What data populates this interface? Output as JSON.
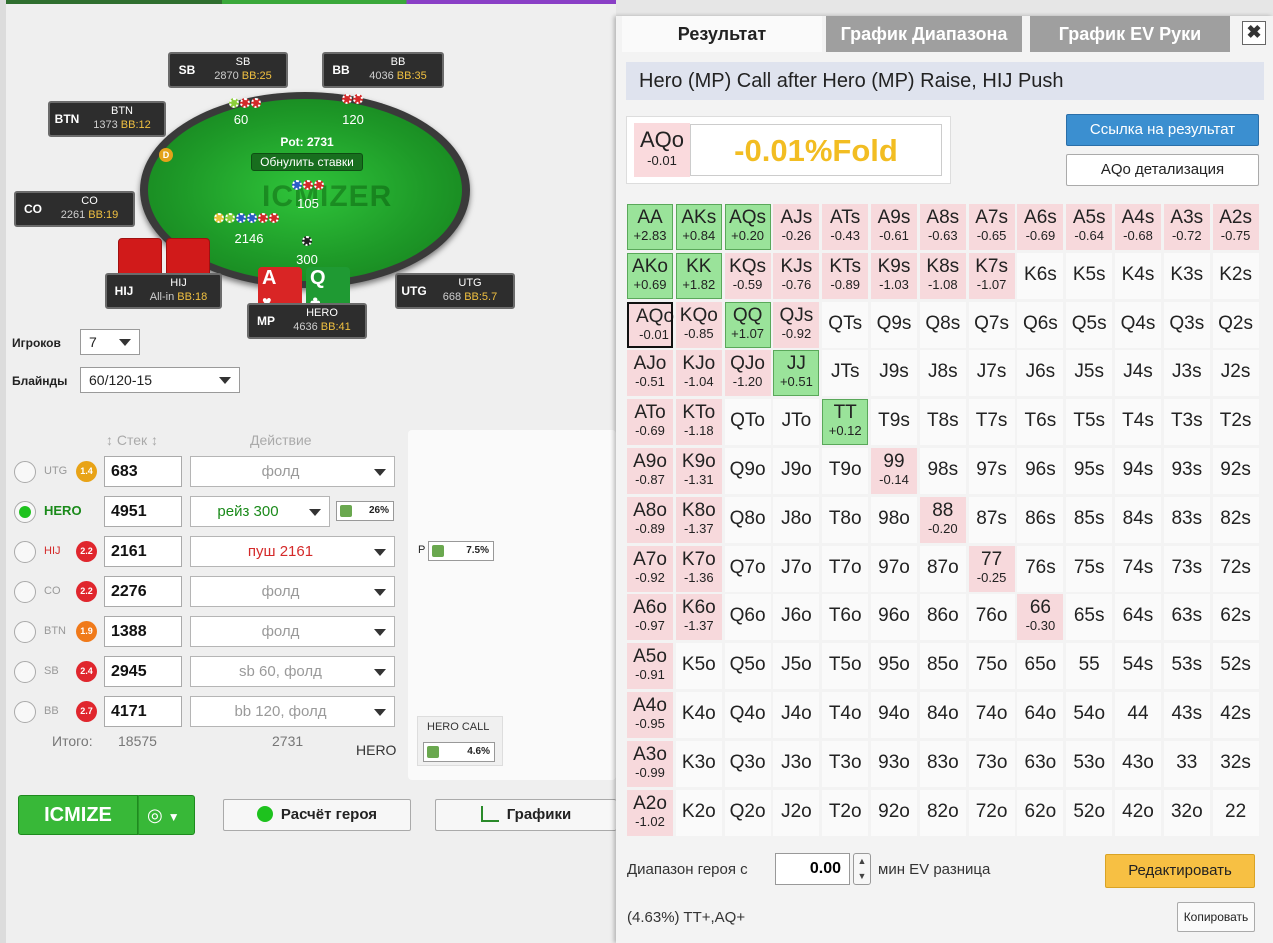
{
  "table": {
    "pot_label": "Pot: 2731",
    "reset_label": "Обнулить ставки",
    "watermark": "ICMIZER",
    "bets": {
      "sb": "60",
      "bb": "120",
      "hij": "2146",
      "hero": "300",
      "center": "105"
    },
    "dealer": "D",
    "seats": {
      "sb": {
        "pos": "SB",
        "name": "SB",
        "stack": "2870",
        "bb": "BB:25"
      },
      "bb": {
        "pos": "BB",
        "name": "BB",
        "stack": "4036",
        "bb": "BB:35"
      },
      "btn": {
        "pos": "BTN",
        "name": "BTN",
        "stack": "1373",
        "bb": "BB:12"
      },
      "co": {
        "pos": "CO",
        "name": "CO",
        "stack": "2261",
        "bb": "BB:19"
      },
      "hij": {
        "pos": "HIJ",
        "name": "HIJ",
        "stack": "All-in",
        "bb": "BB:18"
      },
      "utg": {
        "pos": "UTG",
        "name": "UTG",
        "stack": "668",
        "bb": "BB:5.7"
      },
      "hero": {
        "pos": "MP",
        "name": "HERO",
        "stack": "4636",
        "bb": "BB:41"
      }
    },
    "hero_cards": [
      {
        "rank": "A",
        "suit": "♥"
      },
      {
        "rank": "Q",
        "suit": "♣"
      }
    ]
  },
  "settings": {
    "players_label": "Игроков",
    "players_value": "7",
    "blinds_label": "Блайнды",
    "blinds_value": "60/120-15"
  },
  "columns": {
    "stack": "Стек",
    "action": "Действие"
  },
  "players": [
    {
      "name": "UTG",
      "badge": "1.4",
      "badge_color": "#e8a317",
      "stack": "683",
      "action": "фолд",
      "selected": false
    },
    {
      "name": "HERO",
      "badge": "",
      "badge_color": "",
      "stack": "4951",
      "action": "рейз 300",
      "selected": true,
      "pct": "26%"
    },
    {
      "name": "HIJ",
      "badge": "2.2",
      "badge_color": "#e0262d",
      "stack": "2161",
      "action": "пуш 2161",
      "selected": false
    },
    {
      "name": "CO",
      "badge": "2.2",
      "badge_color": "#e0262d",
      "stack": "2276",
      "action": "фолд",
      "selected": false
    },
    {
      "name": "BTN",
      "badge": "1.9",
      "badge_color": "#f07a1a",
      "stack": "1388",
      "action": "фолд",
      "selected": false
    },
    {
      "name": "SB",
      "badge": "2.4",
      "badge_color": "#e0262d",
      "stack": "2945",
      "action": "sb 60, фолд",
      "selected": false
    },
    {
      "name": "BB",
      "badge": "2.7",
      "badge_color": "#e0262d",
      "stack": "4171",
      "action": "bb 120, фолд",
      "selected": false
    }
  ],
  "totals": {
    "label": "Итого:",
    "stack": "18575",
    "action": "2731"
  },
  "range_pane": {
    "p_label": "P",
    "p_pct": "7.5%",
    "call_label": "HERO CALL",
    "call_pct": "4.6%",
    "hero_label": "HERO"
  },
  "buttons": {
    "icmize": "ICMIZE",
    "icmize_dd": "◎",
    "hero_calc": "Расчёт героя",
    "charts": "Графики"
  },
  "tabs": [
    "Результат",
    "График Диапазона",
    "График EV Руки"
  ],
  "close": "✖",
  "scenario": "Hero (MP) Call after Hero (MP) Raise, HIJ Push",
  "result": {
    "hand": "AQo",
    "ev": "-0.01",
    "text": "-0.01%Fold"
  },
  "link_button": "Ссылка на результат",
  "detail_button": "AQo детализация",
  "range_label": "Диапазон героя с",
  "min_ev_value": "0.00",
  "min_ev_label": "мин EV разница",
  "edit_button": "Редактировать",
  "range_summary": "(4.63%) TT+,AQ+",
  "copy_button": "Копировать",
  "grid": [
    [
      [
        "AA",
        "+2.83",
        "pos"
      ],
      [
        "AKs",
        "+0.84",
        "pos"
      ],
      [
        "AQs",
        "+0.20",
        "pos"
      ],
      [
        "AJs",
        "-0.26",
        "neg"
      ],
      [
        "ATs",
        "-0.43",
        "neg"
      ],
      [
        "A9s",
        "-0.61",
        "neg"
      ],
      [
        "A8s",
        "-0.63",
        "neg"
      ],
      [
        "A7s",
        "-0.65",
        "neg"
      ],
      [
        "A6s",
        "-0.69",
        "neg"
      ],
      [
        "A5s",
        "-0.64",
        "neg"
      ],
      [
        "A4s",
        "-0.68",
        "neg"
      ],
      [
        "A3s",
        "-0.72",
        "neg"
      ],
      [
        "A2s",
        "-0.75",
        "neg"
      ]
    ],
    [
      [
        "AKo",
        "+0.69",
        "pos"
      ],
      [
        "KK",
        "+1.82",
        "pos"
      ],
      [
        "KQs",
        "-0.59",
        "neg"
      ],
      [
        "KJs",
        "-0.76",
        "neg"
      ],
      [
        "KTs",
        "-0.89",
        "neg"
      ],
      [
        "K9s",
        "-1.03",
        "neg"
      ],
      [
        "K8s",
        "-1.08",
        "neg"
      ],
      [
        "K7s",
        "-1.07",
        "neg"
      ],
      [
        "K6s",
        "",
        ""
      ],
      [
        "K5s",
        "",
        ""
      ],
      [
        "K4s",
        "",
        ""
      ],
      [
        "K3s",
        "",
        ""
      ],
      [
        "K2s",
        "",
        ""
      ]
    ],
    [
      [
        "AQo",
        "-0.01",
        "sel"
      ],
      [
        "KQo",
        "-0.85",
        "neg"
      ],
      [
        "QQ",
        "+1.07",
        "pos"
      ],
      [
        "QJs",
        "-0.92",
        "neg"
      ],
      [
        "QTs",
        "",
        ""
      ],
      [
        "Q9s",
        "",
        ""
      ],
      [
        "Q8s",
        "",
        ""
      ],
      [
        "Q7s",
        "",
        ""
      ],
      [
        "Q6s",
        "",
        ""
      ],
      [
        "Q5s",
        "",
        ""
      ],
      [
        "Q4s",
        "",
        ""
      ],
      [
        "Q3s",
        "",
        ""
      ],
      [
        "Q2s",
        "",
        ""
      ]
    ],
    [
      [
        "AJo",
        "-0.51",
        "neg"
      ],
      [
        "KJo",
        "-1.04",
        "neg"
      ],
      [
        "QJo",
        "-1.20",
        "neg"
      ],
      [
        "JJ",
        "+0.51",
        "pos"
      ],
      [
        "JTs",
        "",
        ""
      ],
      [
        "J9s",
        "",
        ""
      ],
      [
        "J8s",
        "",
        ""
      ],
      [
        "J7s",
        "",
        ""
      ],
      [
        "J6s",
        "",
        ""
      ],
      [
        "J5s",
        "",
        ""
      ],
      [
        "J4s",
        "",
        ""
      ],
      [
        "J3s",
        "",
        ""
      ],
      [
        "J2s",
        "",
        ""
      ]
    ],
    [
      [
        "ATo",
        "-0.69",
        "neg"
      ],
      [
        "KTo",
        "-1.18",
        "neg"
      ],
      [
        "QTo",
        "",
        ""
      ],
      [
        "JTo",
        "",
        ""
      ],
      [
        "TT",
        "+0.12",
        "pos"
      ],
      [
        "T9s",
        "",
        ""
      ],
      [
        "T8s",
        "",
        ""
      ],
      [
        "T7s",
        "",
        ""
      ],
      [
        "T6s",
        "",
        ""
      ],
      [
        "T5s",
        "",
        ""
      ],
      [
        "T4s",
        "",
        ""
      ],
      [
        "T3s",
        "",
        ""
      ],
      [
        "T2s",
        "",
        ""
      ]
    ],
    [
      [
        "A9o",
        "-0.87",
        "neg"
      ],
      [
        "K9o",
        "-1.31",
        "neg"
      ],
      [
        "Q9o",
        "",
        ""
      ],
      [
        "J9o",
        "",
        ""
      ],
      [
        "T9o",
        "",
        ""
      ],
      [
        "99",
        "-0.14",
        "neg"
      ],
      [
        "98s",
        "",
        ""
      ],
      [
        "97s",
        "",
        ""
      ],
      [
        "96s",
        "",
        ""
      ],
      [
        "95s",
        "",
        ""
      ],
      [
        "94s",
        "",
        ""
      ],
      [
        "93s",
        "",
        ""
      ],
      [
        "92s",
        "",
        ""
      ]
    ],
    [
      [
        "A8o",
        "-0.89",
        "neg"
      ],
      [
        "K8o",
        "-1.37",
        "neg"
      ],
      [
        "Q8o",
        "",
        ""
      ],
      [
        "J8o",
        "",
        ""
      ],
      [
        "T8o",
        "",
        ""
      ],
      [
        "98o",
        "",
        ""
      ],
      [
        "88",
        "-0.20",
        "neg"
      ],
      [
        "87s",
        "",
        ""
      ],
      [
        "86s",
        "",
        ""
      ],
      [
        "85s",
        "",
        ""
      ],
      [
        "84s",
        "",
        ""
      ],
      [
        "83s",
        "",
        ""
      ],
      [
        "82s",
        "",
        ""
      ]
    ],
    [
      [
        "A7o",
        "-0.92",
        "neg"
      ],
      [
        "K7o",
        "-1.36",
        "neg"
      ],
      [
        "Q7o",
        "",
        ""
      ],
      [
        "J7o",
        "",
        ""
      ],
      [
        "T7o",
        "",
        ""
      ],
      [
        "97o",
        "",
        ""
      ],
      [
        "87o",
        "",
        ""
      ],
      [
        "77",
        "-0.25",
        "neg"
      ],
      [
        "76s",
        "",
        ""
      ],
      [
        "75s",
        "",
        ""
      ],
      [
        "74s",
        "",
        ""
      ],
      [
        "73s",
        "",
        ""
      ],
      [
        "72s",
        "",
        ""
      ]
    ],
    [
      [
        "A6o",
        "-0.97",
        "neg"
      ],
      [
        "K6o",
        "-1.37",
        "neg"
      ],
      [
        "Q6o",
        "",
        ""
      ],
      [
        "J6o",
        "",
        ""
      ],
      [
        "T6o",
        "",
        ""
      ],
      [
        "96o",
        "",
        ""
      ],
      [
        "86o",
        "",
        ""
      ],
      [
        "76o",
        "",
        ""
      ],
      [
        "66",
        "-0.30",
        "neg"
      ],
      [
        "65s",
        "",
        ""
      ],
      [
        "64s",
        "",
        ""
      ],
      [
        "63s",
        "",
        ""
      ],
      [
        "62s",
        "",
        ""
      ]
    ],
    [
      [
        "A5o",
        "-0.91",
        "neg"
      ],
      [
        "K5o",
        "",
        ""
      ],
      [
        "Q5o",
        "",
        ""
      ],
      [
        "J5o",
        "",
        ""
      ],
      [
        "T5o",
        "",
        ""
      ],
      [
        "95o",
        "",
        ""
      ],
      [
        "85o",
        "",
        ""
      ],
      [
        "75o",
        "",
        ""
      ],
      [
        "65o",
        "",
        ""
      ],
      [
        "55",
        "",
        ""
      ],
      [
        "54s",
        "",
        ""
      ],
      [
        "53s",
        "",
        ""
      ],
      [
        "52s",
        "",
        ""
      ]
    ],
    [
      [
        "A4o",
        "-0.95",
        "neg"
      ],
      [
        "K4o",
        "",
        ""
      ],
      [
        "Q4o",
        "",
        ""
      ],
      [
        "J4o",
        "",
        ""
      ],
      [
        "T4o",
        "",
        ""
      ],
      [
        "94o",
        "",
        ""
      ],
      [
        "84o",
        "",
        ""
      ],
      [
        "74o",
        "",
        ""
      ],
      [
        "64o",
        "",
        ""
      ],
      [
        "54o",
        "",
        ""
      ],
      [
        "44",
        "",
        ""
      ],
      [
        "43s",
        "",
        ""
      ],
      [
        "42s",
        "",
        ""
      ]
    ],
    [
      [
        "A3o",
        "-0.99",
        "neg"
      ],
      [
        "K3o",
        "",
        ""
      ],
      [
        "Q3o",
        "",
        ""
      ],
      [
        "J3o",
        "",
        ""
      ],
      [
        "T3o",
        "",
        ""
      ],
      [
        "93o",
        "",
        ""
      ],
      [
        "83o",
        "",
        ""
      ],
      [
        "73o",
        "",
        ""
      ],
      [
        "63o",
        "",
        ""
      ],
      [
        "53o",
        "",
        ""
      ],
      [
        "43o",
        "",
        ""
      ],
      [
        "33",
        "",
        ""
      ],
      [
        "32s",
        "",
        ""
      ]
    ],
    [
      [
        "A2o",
        "-1.02",
        "neg"
      ],
      [
        "K2o",
        "",
        ""
      ],
      [
        "Q2o",
        "",
        ""
      ],
      [
        "J2o",
        "",
        ""
      ],
      [
        "T2o",
        "",
        ""
      ],
      [
        "92o",
        "",
        ""
      ],
      [
        "82o",
        "",
        ""
      ],
      [
        "72o",
        "",
        ""
      ],
      [
        "62o",
        "",
        ""
      ],
      [
        "52o",
        "",
        ""
      ],
      [
        "42o",
        "",
        ""
      ],
      [
        "32o",
        "",
        ""
      ],
      [
        "22",
        "",
        ""
      ]
    ]
  ]
}
